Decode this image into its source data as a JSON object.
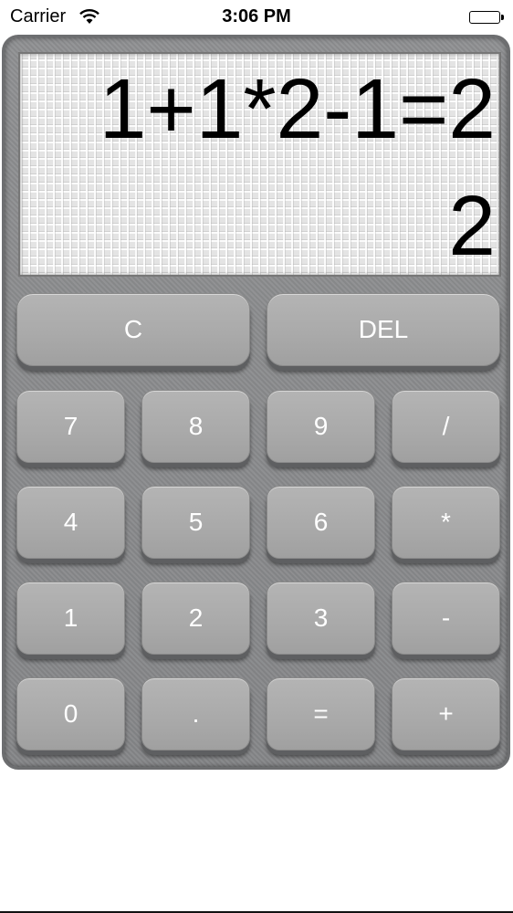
{
  "status_bar": {
    "carrier": "Carrier",
    "time": "3:06 PM",
    "wifi_icon": "wifi-icon",
    "battery_icon": "battery-full-icon"
  },
  "display": {
    "expression": "1+1*2-1=2",
    "result": "2"
  },
  "keys": {
    "clear": "C",
    "delete": "DEL",
    "seven": "7",
    "eight": "8",
    "nine": "9",
    "divide": "/",
    "four": "4",
    "five": "5",
    "six": "6",
    "multiply": "*",
    "one": "1",
    "two": "2",
    "three": "3",
    "subtract": "-",
    "zero": "0",
    "decimal": ".",
    "equals": "=",
    "add": "+"
  },
  "colors": {
    "key_face": "#aaaaaa",
    "key_text": "#ffffff",
    "body": "#8a8b8d",
    "display_bg": "#e4e4e4"
  }
}
